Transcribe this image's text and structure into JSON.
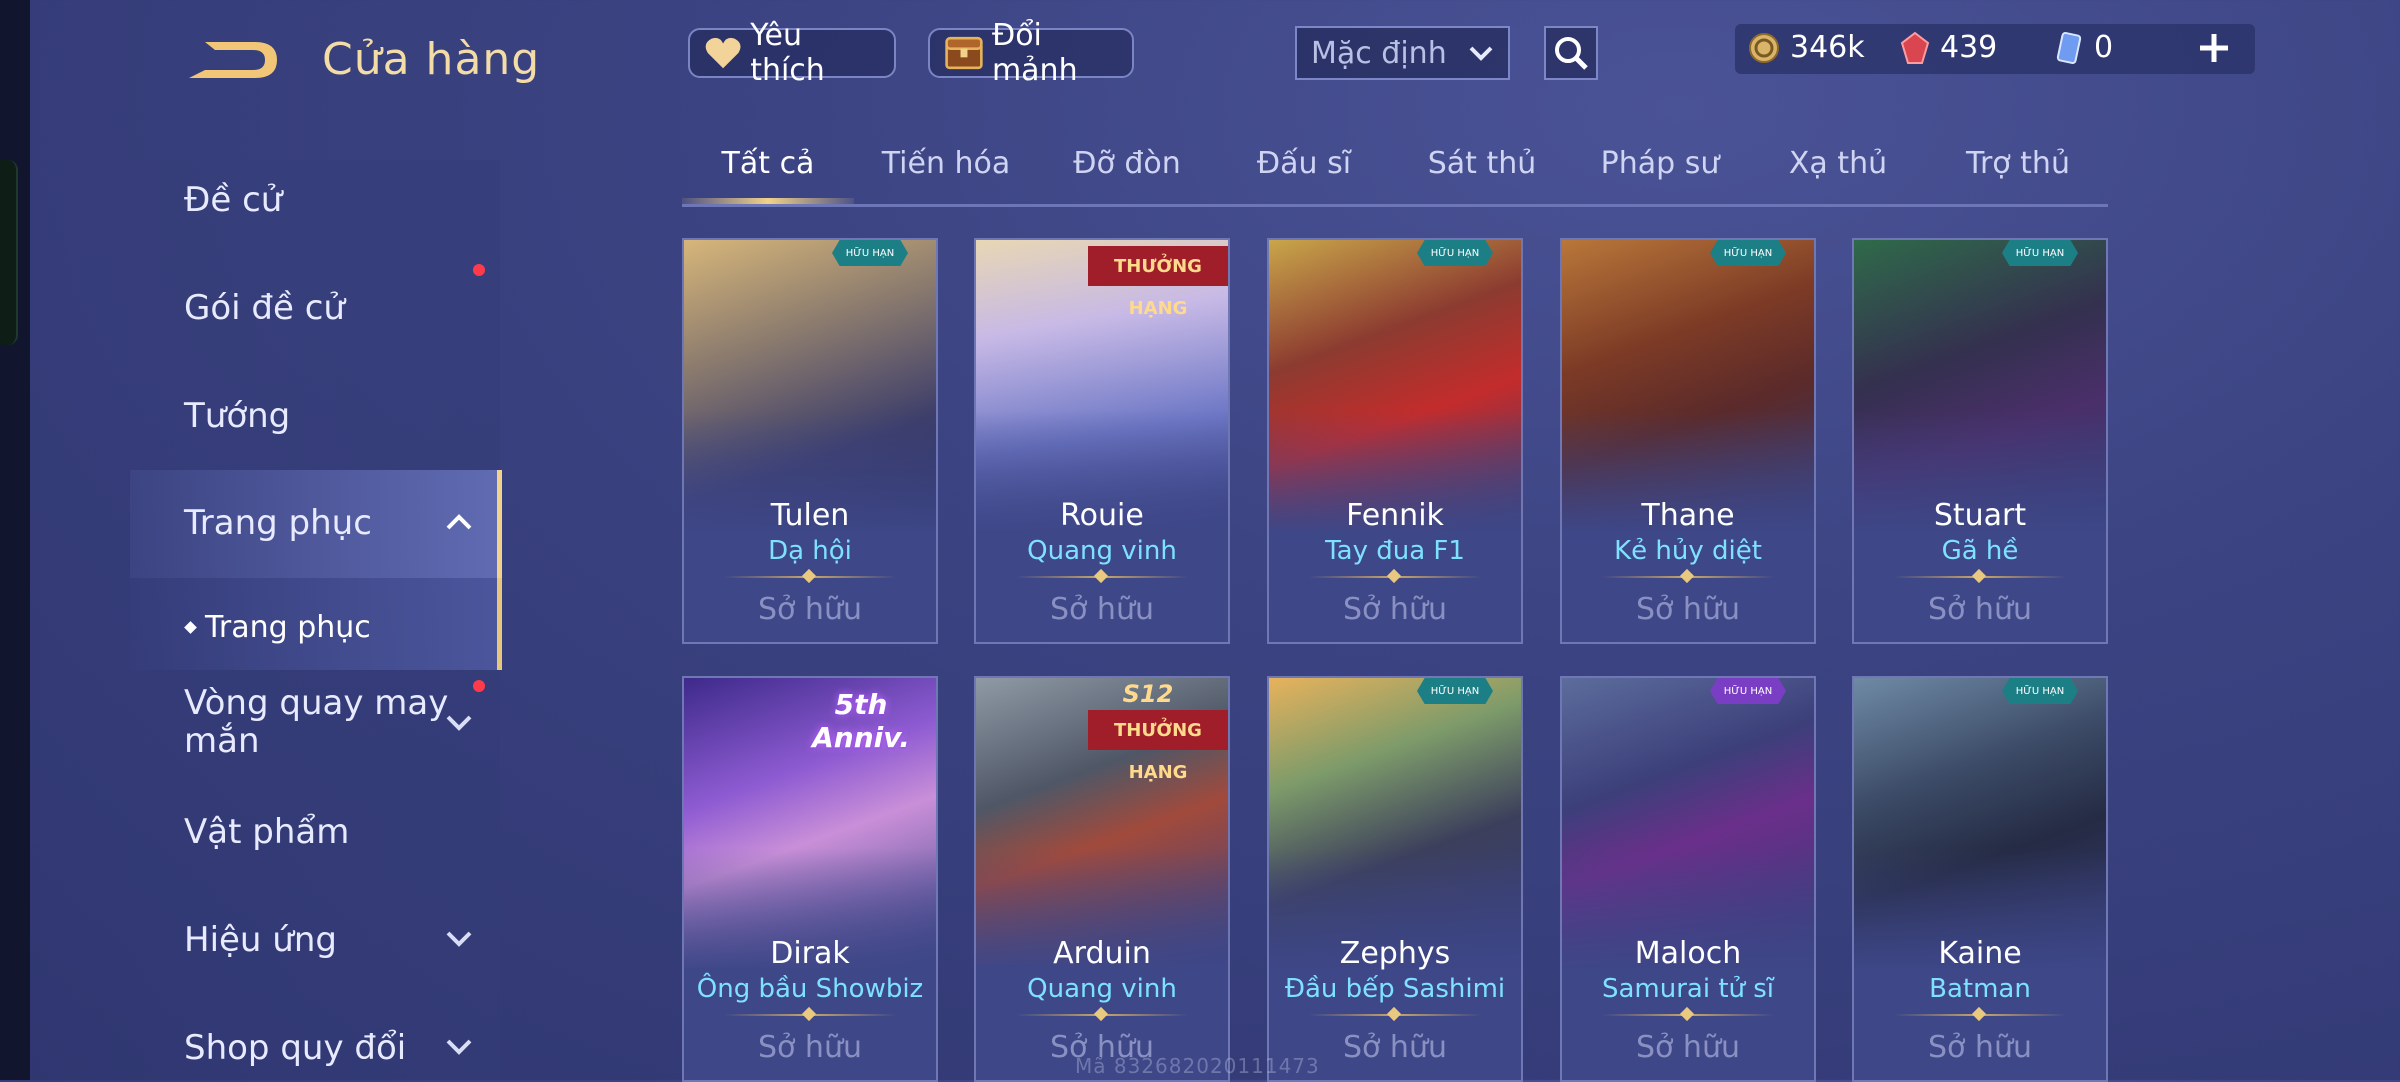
{
  "header": {
    "title": "Cửa hàng",
    "favorite_label": "Yêu thích",
    "shard_label": "Đổi mảnh",
    "sort_value": "Mặc định",
    "currencies": {
      "gold": "346k",
      "vouchers": "439",
      "tickets": "0"
    }
  },
  "sidebar": {
    "items": [
      {
        "label": "Đề cử"
      },
      {
        "label": "Gói đề cử"
      },
      {
        "label": "Tướng"
      },
      {
        "label": "Trang phục"
      },
      {
        "label": "Vòng quay may mắn"
      },
      {
        "label": "Vật phẩm"
      },
      {
        "label": "Hiệu ứng"
      },
      {
        "label": "Shop quy đổi"
      }
    ],
    "sub_item": "Trang phục"
  },
  "tabs": [
    "Tất cả",
    "Tiến hóa",
    "Đỡ đòn",
    "Đấu sĩ",
    "Sát thủ",
    "Pháp sư",
    "Xạ thủ",
    "Trợ thủ"
  ],
  "active_tab": "Tất cả",
  "cards": [
    {
      "name": "Tulen",
      "skin": "Dạ hội",
      "status": "Sở hữu",
      "badge": "A",
      "badge_text": "HỮU HẠN"
    },
    {
      "name": "Rouie",
      "skin": "Quang vinh",
      "status": "Sở hữu",
      "ribbon": "THƯỞNG HẠNG"
    },
    {
      "name": "Fennik",
      "skin": "Tay đua F1",
      "status": "Sở hữu",
      "badge": "A",
      "badge_text": "HỮU HẠN"
    },
    {
      "name": "Thane",
      "skin": "Kẻ hủy diệt",
      "status": "Sở hữu",
      "badge": "A",
      "badge_text": "HỮU HẠN"
    },
    {
      "name": "Stuart",
      "skin": "Gã hề",
      "status": "Sở hữu",
      "badge": "A",
      "badge_text": "HỮU HẠN"
    },
    {
      "name": "Dirak",
      "skin": "Ông bầu Showbiz",
      "status": "Sở hữu",
      "anniv": "5th Anniv."
    },
    {
      "name": "Arduin",
      "skin": "Quang vinh",
      "status": "Sở hữu",
      "season": "S12",
      "ribbon": "THƯỞNG HẠNG"
    },
    {
      "name": "Zephys",
      "skin": "Đầu bếp Sashimi",
      "status": "Sở hữu",
      "badge": "A",
      "badge_text": "HỮU HẠN"
    },
    {
      "name": "Maloch",
      "skin": "Samurai tử sĩ",
      "status": "Sở hữu",
      "badge": "S",
      "badge_text": "HỮU HẠN"
    },
    {
      "name": "Kaine",
      "skin": "Batman",
      "status": "Sở hữu",
      "badge": "A",
      "badge_text": "HỮU HẠN"
    }
  ],
  "watermark": "Mã 832682020111473",
  "colors": {
    "accent_gold": "#f1d28a",
    "skin_name_cyan": "#7ee1ff",
    "notification_red": "#ff3b4b"
  }
}
